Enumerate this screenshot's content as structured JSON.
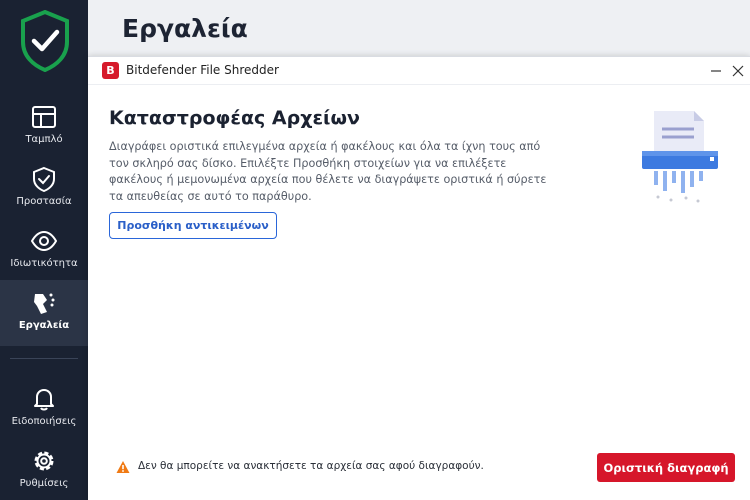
{
  "sidebar": {
    "items": [
      {
        "label": "Ταμπλό",
        "icon": "dashboard-icon"
      },
      {
        "label": "Προστασία",
        "icon": "shield-icon"
      },
      {
        "label": "Ιδιωτικότητα",
        "icon": "eye-icon"
      },
      {
        "label": "Εργαλεία",
        "icon": "tools-icon",
        "active": true
      },
      {
        "label": "Ειδοποιήσεις",
        "icon": "bell-icon"
      },
      {
        "label": "Ρυθμίσεις",
        "icon": "gear-icon"
      }
    ]
  },
  "page": {
    "title": "Εργαλεία"
  },
  "dialog": {
    "badge": "B",
    "window_title": "Bitdefender File Shredder",
    "heading": "Καταστροφέας Αρχείων",
    "description": "Διαγράφει οριστικά επιλεγμένα αρχεία ή φακέλους και όλα τα ίχνη τους από τον σκληρό σας δίσκο. Επιλέξτε Προσθήκη στοιχείων για να επιλέξετε φακέλους ή μεμονωμένα αρχεία που θέλετε να διαγράψετε οριστικά ή σύρετε τα απευθείας σε αυτό το παράθυρο.",
    "add_button": "Προσθήκη αντικειμένων",
    "warning": "Δεν θα μπορείτε να ανακτήσετε τα αρχεία σας αφού διαγραφούν.",
    "delete_button": "Οριστική διαγραφή"
  },
  "colors": {
    "sidebar": "#1a2232",
    "accent_red": "#d6162a",
    "accent_blue": "#2a66d9",
    "logo_green": "#19a14d"
  }
}
